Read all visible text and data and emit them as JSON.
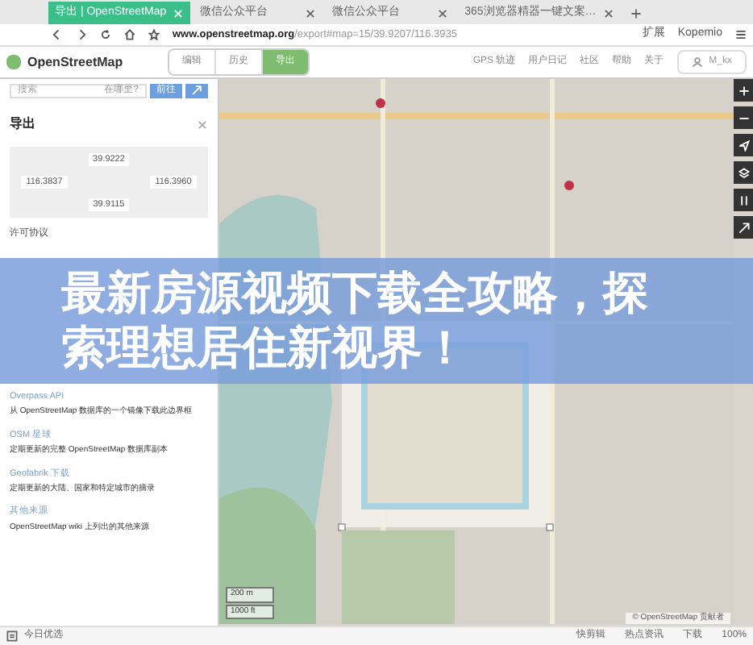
{
  "browser_tabs": [
    {
      "label": "导出 | OpenStreetMap",
      "selected": true
    },
    {
      "label": "微信公众平台",
      "selected": false
    },
    {
      "label": "微信公众平台",
      "selected": false
    },
    {
      "label": "365浏览器精器一键文案…",
      "selected": false
    }
  ],
  "address_bar": {
    "url_host": "www.openstreetmap.org",
    "url_path": "/export#map=15/39.9207/116.3935",
    "extensions": [
      "扩展",
      "Kopemio"
    ]
  },
  "site_header": {
    "logo": "OpenStreetMap",
    "nav": [
      {
        "label": "编辑",
        "selected": false
      },
      {
        "label": "历史",
        "selected": false
      },
      {
        "label": "导出",
        "selected": true
      }
    ],
    "links": [
      "GPS 轨迹",
      "用户日记",
      "社区",
      "帮助",
      "关于"
    ],
    "user": "M_kx"
  },
  "sidebar": {
    "search": {
      "placeholder": "搜索",
      "where": "在哪里?",
      "go": "前往"
    },
    "title": "导出",
    "bounds": {
      "north": "39.9222",
      "west": "116.3837",
      "east": "116.3960",
      "south": "39.9115"
    },
    "license": "许可协议",
    "sources": [
      {
        "name": "Overpass API",
        "desc": "从 OpenStreetMap 数据库的一个镜像下载此边界框"
      },
      {
        "name": "OSM 星球",
        "desc": "定期更新的完整 OpenStreetMap 数据库副本"
      },
      {
        "name": "Geofabrik 下载",
        "desc": "定期更新的大陆、国家和特定城市的摘录"
      },
      {
        "name": "其他来源",
        "desc": "OpenStreetMap wiki 上列出的其他来源"
      }
    ]
  },
  "map": {
    "scale": [
      "200 m",
      "1000 ft"
    ],
    "attribution": "© OpenStreetMap 贡献者"
  },
  "banner": {
    "lines": [
      "最新房源视频下载全攻略，探",
      "索理想居住新视界！"
    ]
  },
  "status_bar": {
    "left": "今日优选",
    "items": [
      "快剪辑",
      "热点资讯",
      "下载",
      "100%"
    ]
  }
}
